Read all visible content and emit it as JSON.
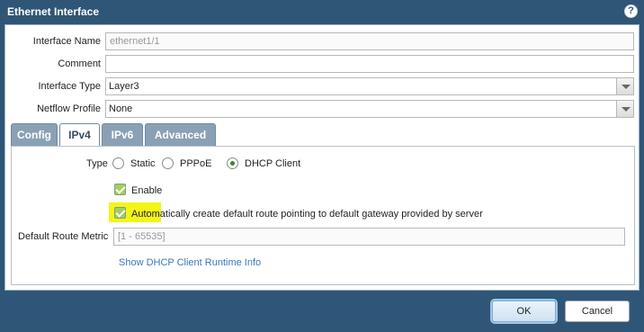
{
  "dialog": {
    "title": "Ethernet Interface",
    "help_icon": "?"
  },
  "fields": {
    "interface_name": {
      "label": "Interface Name",
      "value": "ethernet1/1"
    },
    "comment": {
      "label": "Comment",
      "value": ""
    },
    "interface_type": {
      "label": "Interface Type",
      "value": "Layer3"
    },
    "netflow_profile": {
      "label": "Netflow Profile",
      "value": "None"
    }
  },
  "tabs": [
    {
      "label": "Config"
    },
    {
      "label": "IPv4"
    },
    {
      "label": "IPv6"
    },
    {
      "label": "Advanced"
    }
  ],
  "ipv4": {
    "type_label": "Type",
    "type_options": [
      "Static",
      "PPPoE",
      "DHCP Client"
    ],
    "selected_type": "DHCP Client",
    "enable_label": "Enable",
    "auto_route_label": "Automatically create default route pointing to default gateway provided by server",
    "metric_label": "Default Route Metric",
    "metric_placeholder": "[1 - 65535]",
    "runtime_link": "Show DHCP Client Runtime Info"
  },
  "buttons": {
    "ok": "OK",
    "cancel": "Cancel"
  },
  "colors": {
    "frame": "#2f5677",
    "highlight": "#f3f516",
    "checkbox": "#a6cd5f",
    "link": "#3a78b8"
  }
}
